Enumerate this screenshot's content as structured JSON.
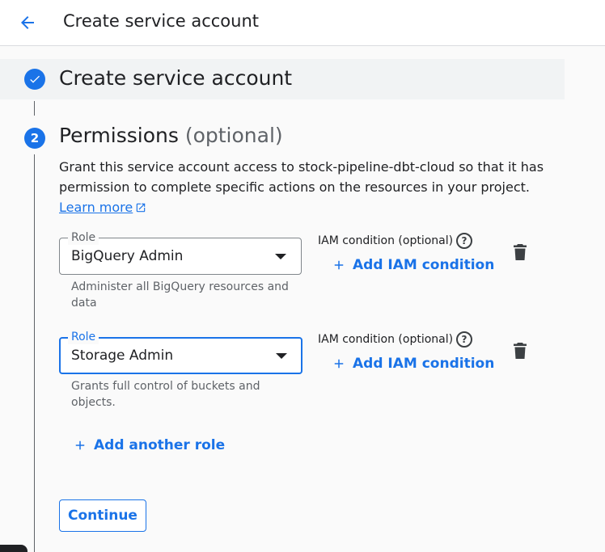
{
  "header": {
    "title": "Create service account",
    "back_icon": "arrow-back-icon"
  },
  "step1": {
    "title": "Create service account",
    "status_icon": "check-circle-icon"
  },
  "step2": {
    "number": "2",
    "title": "Permissions",
    "title_optional": "(optional)",
    "description": "Grant this service account access to stock-pipeline-dbt-cloud so that it has permission to complete specific actions on the resources in your project.",
    "learn_more": "Learn more"
  },
  "roles": [
    {
      "label": "Role",
      "value": "BigQuery Admin",
      "hint": "Administer all BigQuery resources and data",
      "iam_label": "IAM condition (optional)",
      "add_iam": "Add IAM condition",
      "focused": false
    },
    {
      "label": "Role",
      "value": "Storage Admin",
      "hint": "Grants full control of buckets and objects.",
      "iam_label": "IAM condition (optional)",
      "add_iam": "Add IAM condition",
      "focused": true
    }
  ],
  "add_role": "Add another role",
  "continue_label": "Continue",
  "colors": {
    "accent": "#1a73e8",
    "text": "#202124",
    "muted": "#5f6368"
  }
}
